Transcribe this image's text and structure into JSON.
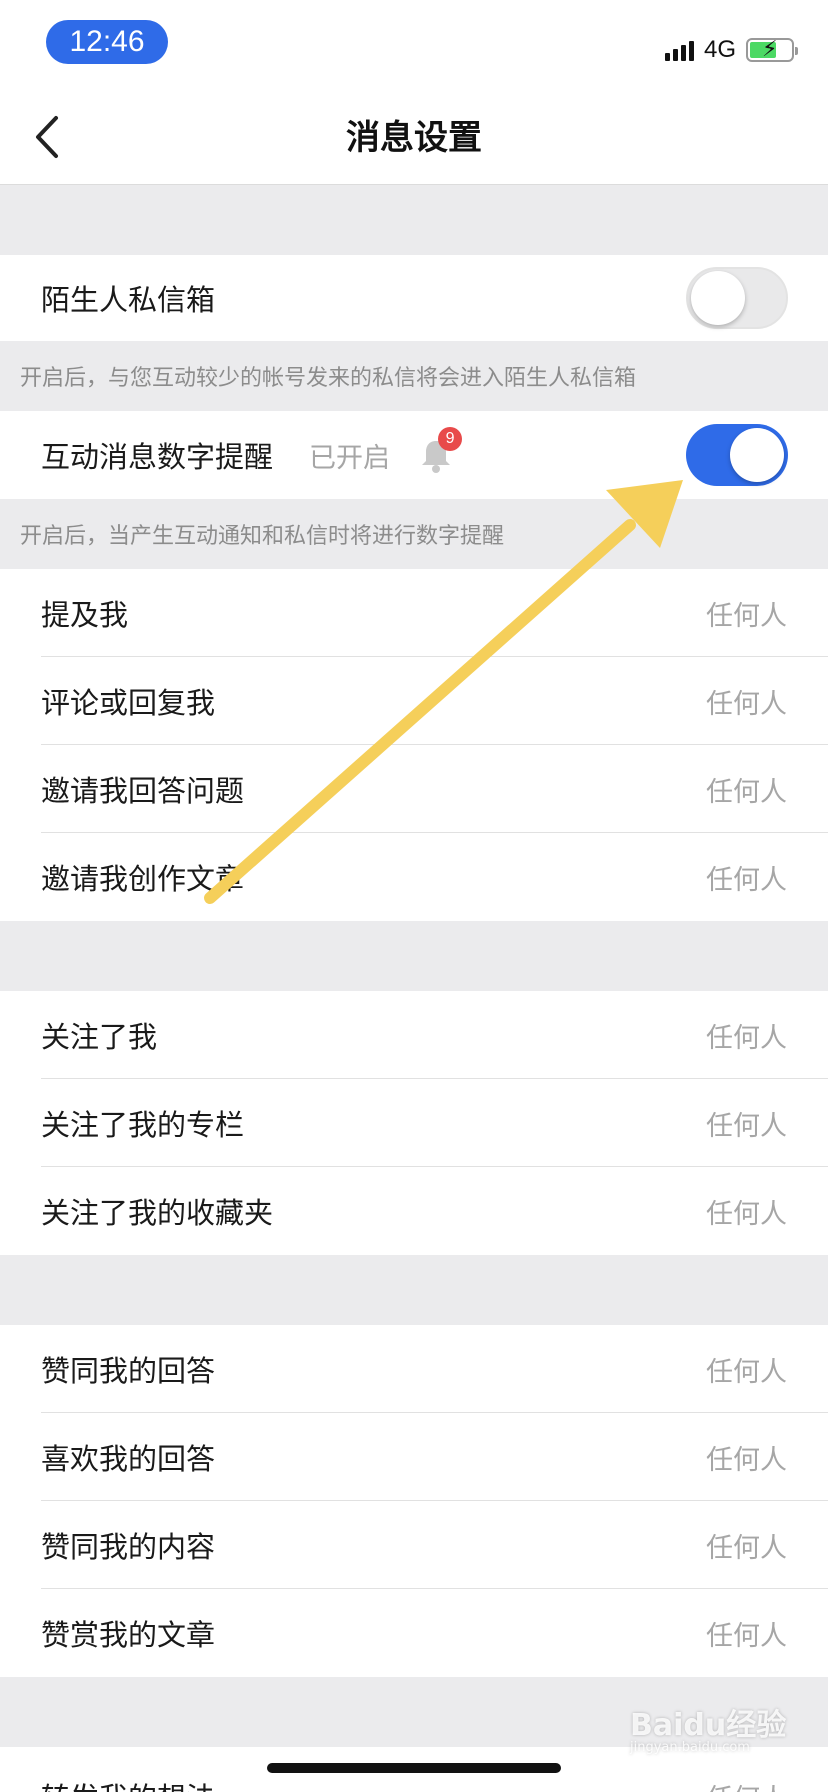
{
  "status_bar": {
    "time": "12:46",
    "network": "4G"
  },
  "header": {
    "title": "消息设置"
  },
  "stranger_inbox": {
    "label": "陌生人私信箱",
    "enabled": false,
    "hint": "开启后，与您互动较少的帐号发来的私信将会进入陌生人私信箱"
  },
  "digit_reminder": {
    "label": "互动消息数字提醒",
    "status": "已开启",
    "badge_count": "9",
    "enabled": true,
    "hint": "开启后，当产生互动通知和私信时将进行数字提醒"
  },
  "section1": {
    "rows": [
      {
        "label": "提及我",
        "value": "任何人"
      },
      {
        "label": "评论或回复我",
        "value": "任何人"
      },
      {
        "label": "邀请我回答问题",
        "value": "任何人"
      },
      {
        "label": "邀请我创作文章",
        "value": "任何人"
      }
    ]
  },
  "section2": {
    "rows": [
      {
        "label": "关注了我",
        "value": "任何人"
      },
      {
        "label": "关注了我的专栏",
        "value": "任何人"
      },
      {
        "label": "关注了我的收藏夹",
        "value": "任何人"
      }
    ]
  },
  "section3": {
    "rows": [
      {
        "label": "赞同我的回答",
        "value": "任何人"
      },
      {
        "label": "喜欢我的回答",
        "value": "任何人"
      },
      {
        "label": "赞同我的内容",
        "value": "任何人"
      },
      {
        "label": "赞赏我的文章",
        "value": "任何人"
      }
    ]
  },
  "section4": {
    "rows": [
      {
        "label": "转发我的想法",
        "value": "任何人"
      }
    ]
  },
  "watermark": {
    "brand": "Baidu经验",
    "domain": "jingyan.baidu.com"
  },
  "colors": {
    "accent": "#2f6be8",
    "annotation_arrow": "#f5cf5a",
    "badge": "#e84a4a",
    "background": "#ebebed"
  },
  "icons": [
    "back-chevron-icon",
    "signal-icon",
    "battery-icon",
    "bell-icon"
  ]
}
